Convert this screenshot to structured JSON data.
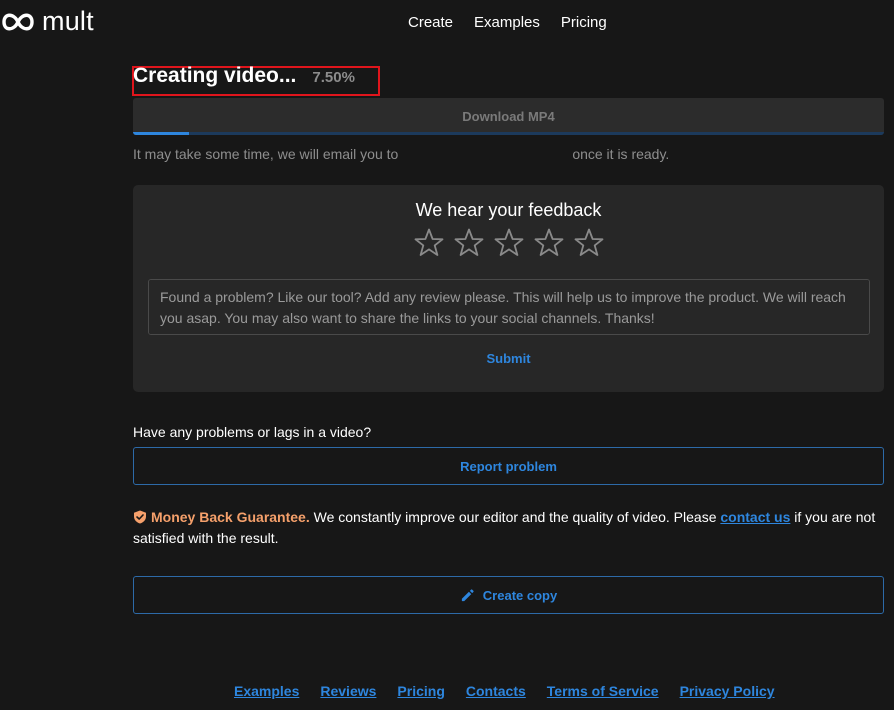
{
  "header": {
    "logo_text": "mult",
    "nav": [
      "Create",
      "Examples",
      "Pricing"
    ]
  },
  "status": {
    "title": "Creating video...",
    "percent": "7.50%",
    "progress_fraction": 0.075
  },
  "download": {
    "label": "Download MP4"
  },
  "info": {
    "before": "It may take some time, we will email you to",
    "after": "once it is ready."
  },
  "feedback": {
    "title": "We hear your feedback",
    "rating": {
      "max": 5,
      "value": 0
    },
    "placeholder": "Found a problem? Like our tool? Add any review please. This will help us to improve the product. We will reach you asap. You may also want to share the links to your social channels. Thanks!",
    "submit_label": "Submit"
  },
  "problems": {
    "question": "Have any problems or lags in a video?",
    "report_label": "Report problem"
  },
  "guarantee": {
    "strong": "Money Back Guarantee.",
    "text": " We constantly improve our editor and the quality of video. Please ",
    "link": "contact us",
    "tail": " if you are not satisfied with the result."
  },
  "copy": {
    "label": "Create copy"
  },
  "footer": {
    "links": [
      "Examples",
      "Reviews",
      "Pricing",
      "Contacts",
      "Terms of Service",
      "Privacy Policy"
    ]
  },
  "colors": {
    "background": "#171717",
    "accent": "#2e86de",
    "guarantee": "#f5a06b",
    "highlight": "#e0151c"
  },
  "icons": [
    "mult-logo-icon",
    "star-icon",
    "shield-check-icon",
    "pencil-icon"
  ]
}
